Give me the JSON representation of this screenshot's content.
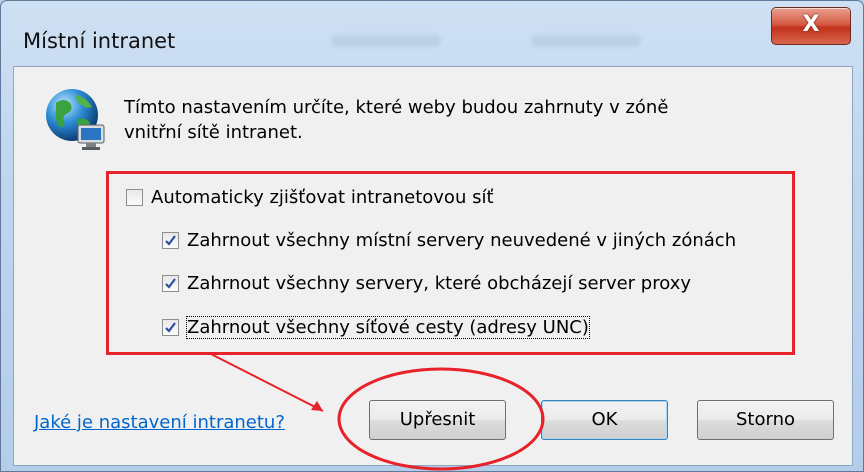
{
  "window": {
    "title": "Místní intranet",
    "close_glyph": "X"
  },
  "description": "Tímto nastavením určíte, které weby budou zahrnuty v zóně vnitřní sítě intranet.",
  "options": [
    {
      "label": "Automaticky zjišťovat intranetovou síť",
      "checked": false
    },
    {
      "label": "Zahrnout všechny místní servery neuvedené v jiných zónách",
      "checked": true
    },
    {
      "label": "Zahrnout všechny servery, které obcházejí server proxy",
      "checked": true
    },
    {
      "label": "Zahrnout všechny síťové cesty (adresy UNC)",
      "checked": true
    }
  ],
  "help_link": "Jaké je nastavení intranetu?",
  "buttons": {
    "advanced": "Upřesnit",
    "ok": "OK",
    "cancel": "Storno"
  },
  "annotation_color": "#e8222a",
  "icon": "globe-network-icon"
}
